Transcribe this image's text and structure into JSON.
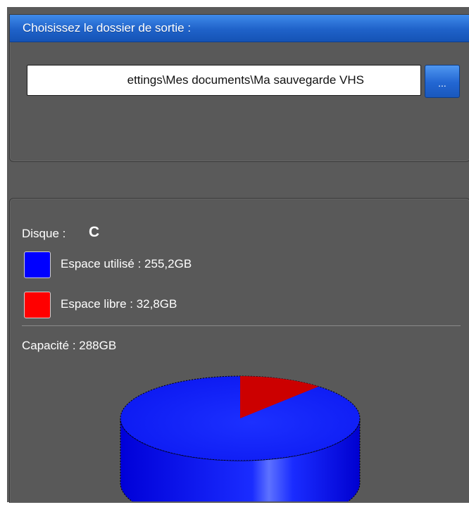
{
  "output_panel": {
    "header_title": "Choisissez le dossier de sortie :",
    "path_value": "ettings\\Mes documents\\Ma sauvegarde VHS",
    "browse_label": "..."
  },
  "disk_panel": {
    "disk_label": "Disque :",
    "disk_letter": "C",
    "used_label": "Espace utilisé : 255,2GB",
    "free_label": "Espace libre : 32,8GB",
    "capacity_label": "Capacité : 288GB",
    "colors": {
      "used": "#0000ff",
      "free": "#ff0000"
    }
  },
  "chart_data": {
    "type": "pie",
    "title": "",
    "categories": [
      "Espace utilisé",
      "Espace libre"
    ],
    "values": [
      255.2,
      32.8
    ],
    "unit": "GB",
    "colors": [
      "#0000ff",
      "#cc0000"
    ]
  }
}
